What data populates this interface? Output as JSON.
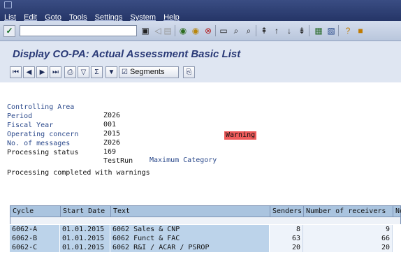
{
  "menu": {
    "items": [
      "List",
      "Edit",
      "Goto",
      "Tools",
      "Settings",
      "System",
      "Help"
    ]
  },
  "toolbar": {
    "command_field_value": "",
    "icons": [
      "enter-icon",
      "save-icon",
      "back-icon",
      "exit-icon",
      "cancel-icon",
      "print-icon",
      "find-icon",
      "find-next-icon",
      "first-page-icon",
      "previous-page-icon",
      "next-page-icon",
      "last-page-icon",
      "create-session-icon",
      "shortcut-icon",
      "help-icon"
    ]
  },
  "title": "Display CO-PA: Actual Assessment Basic List",
  "app_toolbar": {
    "segments_label": "Segments",
    "icons": [
      "first-icon",
      "previous-icon",
      "next-icon",
      "last-icon",
      "print-icon",
      "filter-icon",
      "sum-icon",
      "set-filter-icon",
      "segments-icon",
      "export-icon"
    ]
  },
  "header_info": {
    "rows": [
      {
        "label": "Controlling Area",
        "value": "Z026"
      },
      {
        "label": "Period",
        "value": "001"
      },
      {
        "label": "Fiscal Year",
        "value": "2015"
      },
      {
        "label": "Operating concern",
        "value": "Z026"
      },
      {
        "label": "No. of messages",
        "value": "169"
      },
      {
        "label": "Processing status",
        "value": "TestRun"
      }
    ],
    "max_category_label": "Maximum Category",
    "max_category_value": "Warning",
    "warning_color": "#ef5b5b",
    "message": "Processing completed with warnings"
  },
  "table": {
    "columns": [
      "Cycle",
      "Start Date",
      "Text",
      "Senders",
      "Number of receivers",
      "No"
    ],
    "rows": [
      {
        "cycle": "6062-A",
        "start_date": "01.01.2015",
        "text": "6062 Sales & CNP",
        "senders": "8",
        "receivers": "9"
      },
      {
        "cycle": "6062-B",
        "start_date": "01.01.2015",
        "text": "6062 Funct & FAC",
        "senders": "63",
        "receivers": "66"
      },
      {
        "cycle": "6062-C",
        "start_date": "01.01.2015",
        "text": "6062 R&I / ACAR / PSROP",
        "senders": "20",
        "receivers": "20"
      }
    ]
  }
}
